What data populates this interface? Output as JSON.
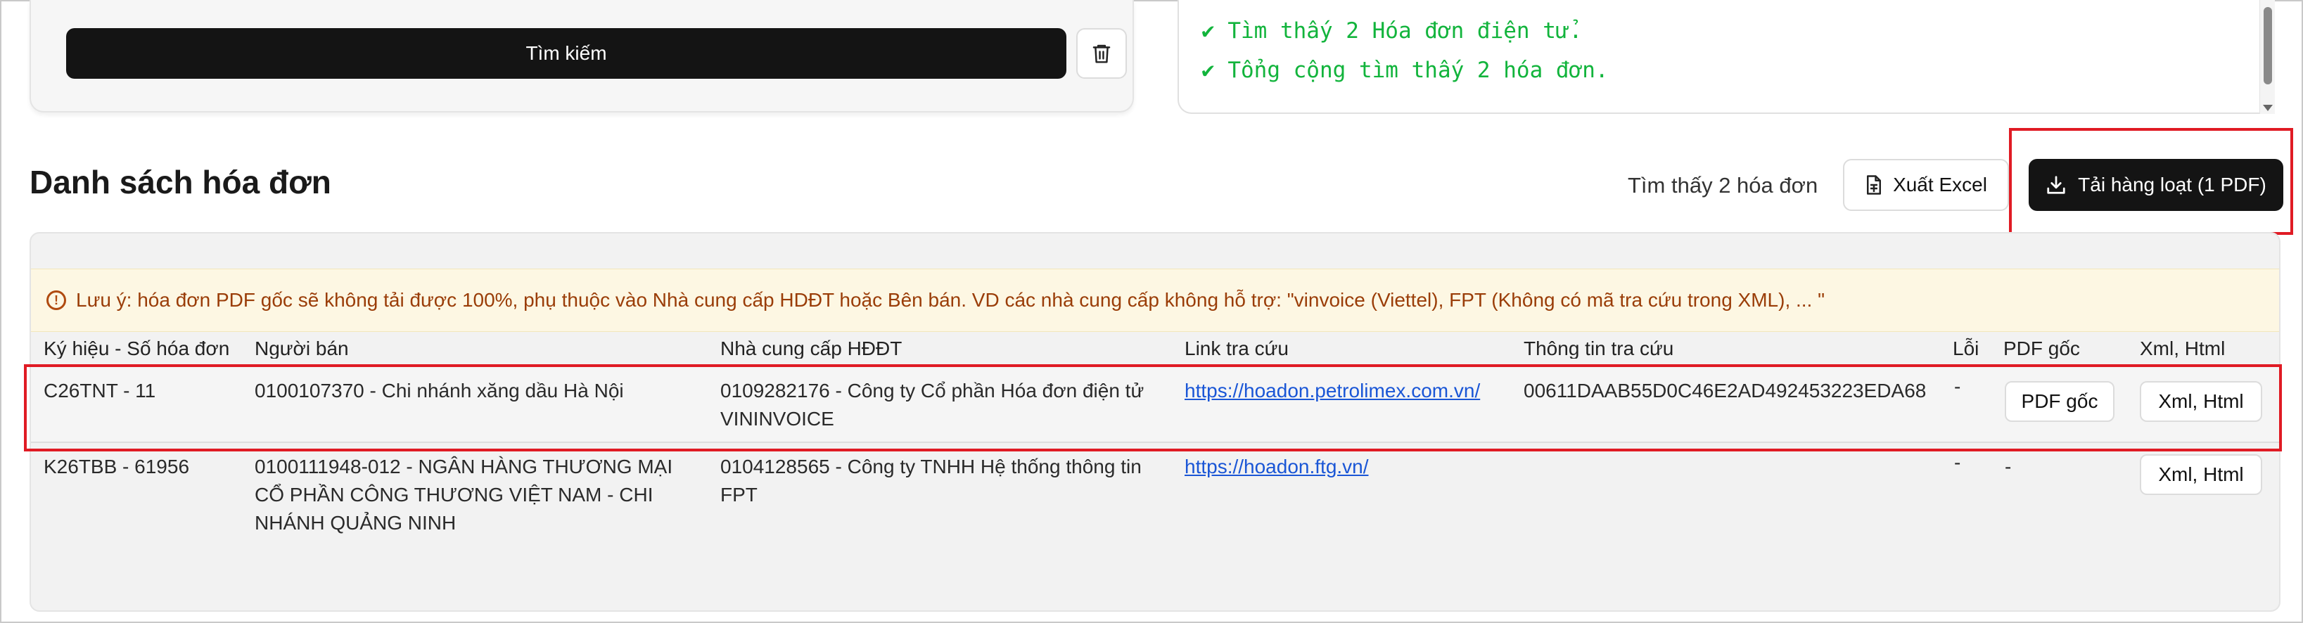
{
  "search": {
    "button_label": "Tìm kiếm",
    "log_lines": [
      "✔ Tìm thấy 2 Hóa đơn điện tử.",
      "✔ Tổng cộng tìm thấy 2 hóa đơn."
    ]
  },
  "list": {
    "title": "Danh sách hóa đơn",
    "found_text": "Tìm thấy 2 hóa đơn",
    "export_excel_label": "Xuất Excel",
    "bulk_download_label": "Tải hàng loạt (1 PDF)",
    "notice": "Lưu ý: hóa đơn PDF gốc sẽ không tải được 100%, phụ thuộc vào Nhà cung cấp HDĐT hoặc Bên bán. VD các nhà cung cấp không hỗ trợ: \"vinvoice (Viettel), FPT (Không có mã tra cứu trong XML), ... \""
  },
  "table": {
    "columns": [
      "Ký hiệu - Số hóa đơn",
      "Người bán",
      "Nhà cung cấp HĐĐT",
      "Link tra cứu",
      "Thông tin tra cứu",
      "Lỗi",
      "PDF gốc",
      "Xml, Html"
    ],
    "rows": [
      {
        "invoice": "C26TNT - 11",
        "seller": "0100107370 - Chi nhánh xăng dầu Hà Nội",
        "provider": "0109282176 - Công ty Cổ phần Hóa đơn điện tử VININVOICE",
        "link": "https://hoadon.petrolimex.com.vn/",
        "lookup_info": "00611DAAB55D0C46E2AD492453223EDA68",
        "error": "-",
        "pdf_label": "PDF gốc",
        "xml_label": "Xml, Html"
      },
      {
        "invoice": "K26TBB - 61956",
        "seller": "0100111948-012 - NGÂN HÀNG THƯƠNG MẠI CỔ PHẦN CÔNG THƯƠNG VIỆT NAM - CHI NHÁNH QUẢNG NINH",
        "provider": "0104128565 - Công ty TNHH Hệ thống thông tin FPT",
        "link": "https://hoadon.ftg.vn/",
        "lookup_info": "",
        "error": "-",
        "pdf_label": "-",
        "xml_label": "Xml, Html"
      }
    ]
  },
  "icons": {
    "trash": "trash-icon",
    "excel": "document-icon",
    "download": "download-icon",
    "notice": "alert-circle-icon"
  },
  "colors": {
    "primary_button": "#141414",
    "log_text": "#12b43c",
    "notice_text": "#9a3d08",
    "notice_bg": "#fdf7e3",
    "link": "#1a56d6",
    "highlight": "#e01b24"
  }
}
